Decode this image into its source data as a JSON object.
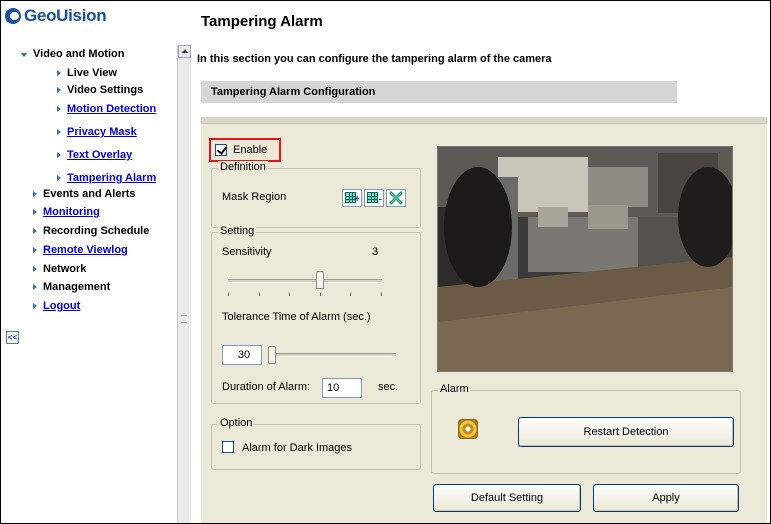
{
  "sidebar": {
    "logo_text": "GeoUision",
    "collapse_label": "<<",
    "items": [
      {
        "label": "Video and Motion",
        "style": "plain",
        "arrow": "down"
      },
      {
        "label": "Live View",
        "style": "plain",
        "arrow": "right"
      },
      {
        "label": "Video Settings",
        "style": "plain",
        "arrow": "right"
      },
      {
        "label": "Motion Detection",
        "style": "link",
        "arrow": "right"
      },
      {
        "label": "Privacy Mask",
        "style": "link",
        "arrow": "right"
      },
      {
        "label": "Text Overlay",
        "style": "link",
        "arrow": "right"
      },
      {
        "label": "Tampering Alarm",
        "style": "current",
        "arrow": "right"
      },
      {
        "label": "Events and Alerts",
        "style": "plain",
        "arrow": "right"
      },
      {
        "label": "Monitoring",
        "style": "link",
        "arrow": "right"
      },
      {
        "label": "Recording Schedule",
        "style": "plain",
        "arrow": "right"
      },
      {
        "label": "Remote Viewlog",
        "style": "link",
        "arrow": "right"
      },
      {
        "label": "Network",
        "style": "plain",
        "arrow": "right"
      },
      {
        "label": "Management",
        "style": "plain",
        "arrow": "right"
      },
      {
        "label": "Logout",
        "style": "link",
        "arrow": "right"
      }
    ]
  },
  "main": {
    "title": "Tampering Alarm",
    "description": "In this section you can configure the tampering alarm of the camera",
    "section_title": "Tampering Alarm Configuration"
  },
  "config": {
    "enable_label": "Enable",
    "enable_checked": true,
    "definition": {
      "legend": "Definition",
      "mask_region_label": "Mask Region",
      "icons": [
        "add-mask-icon",
        "remove-mask-icon",
        "clear-mask-icon"
      ]
    },
    "setting": {
      "legend": "Setting",
      "sensitivity_label": "Sensitivity",
      "sensitivity_value": "3",
      "sensitivity_level": 3,
      "sensitivity_max": 5,
      "tolerance_label": "Tolerance Time of Alarm (sec.)",
      "tolerance_value": "30",
      "tolerance_fraction": 0.0,
      "duration_label": "Duration of Alarm:",
      "duration_value": "10",
      "duration_unit": "sec."
    },
    "option": {
      "legend": "Option",
      "dark_images_label": "Alarm for Dark Images",
      "dark_images_checked": false
    },
    "alarm": {
      "legend": "Alarm",
      "indicator_icon": "alarm-indicator-icon",
      "restart_label": "Restart Detection"
    },
    "buttons": {
      "default_label": "Default Setting",
      "apply_label": "Apply"
    }
  },
  "colors": {
    "brand": "#1b4f9c",
    "link": "#0000cc",
    "panel_bg": "#ece9d8",
    "highlight": "#e0161b"
  }
}
